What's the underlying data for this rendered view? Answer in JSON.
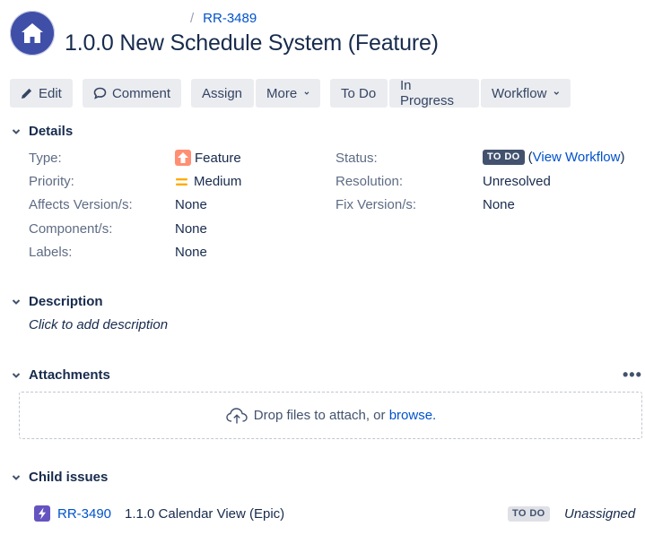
{
  "breadcrumb": {
    "separator": "/",
    "issue_key": "RR-3489"
  },
  "header": {
    "title": "1.0.0 New Schedule System (Feature)"
  },
  "toolbar": {
    "edit": "Edit",
    "comment": "Comment",
    "assign": "Assign",
    "more": "More",
    "todo": "To Do",
    "in_progress": "In Progress",
    "workflow": "Workflow"
  },
  "details": {
    "heading": "Details",
    "type_label": "Type:",
    "type_value": "Feature",
    "priority_label": "Priority:",
    "priority_value": "Medium",
    "affects_label": "Affects Version/s:",
    "affects_value": "None",
    "component_label": "Component/s:",
    "component_value": "None",
    "labels_label": "Labels:",
    "labels_value": "None",
    "status_label": "Status:",
    "status_value": "TO DO",
    "view_workflow_open": "(",
    "view_workflow": "View Workflow",
    "view_workflow_close": ")",
    "resolution_label": "Resolution:",
    "resolution_value": "Unresolved",
    "fix_label": "Fix Version/s:",
    "fix_value": "None"
  },
  "description": {
    "heading": "Description",
    "placeholder": "Click to add description"
  },
  "attachments": {
    "heading": "Attachments",
    "more": "•••",
    "drop_text": "Drop files to attach, or ",
    "browse": "browse."
  },
  "child_issues": {
    "heading": "Child issues",
    "items": [
      {
        "key": "RR-3490",
        "summary": "1.1.0 Calendar View (Epic)",
        "status": "TO DO",
        "assignee": "Unassigned"
      }
    ]
  },
  "colors": {
    "accent": "#0052cc",
    "button_bg": "#ebecf0",
    "feature_icon": "#ff8f73",
    "priority": "#ffab00",
    "epic_icon": "#6554c0",
    "lozenge_dark": "#42526e"
  },
  "icons": [
    "project-avatar-house-icon",
    "pencil-icon",
    "comment-icon",
    "chevron-down-icon",
    "feature-type-icon",
    "priority-medium-icon",
    "cloud-upload-icon",
    "epic-icon"
  ]
}
